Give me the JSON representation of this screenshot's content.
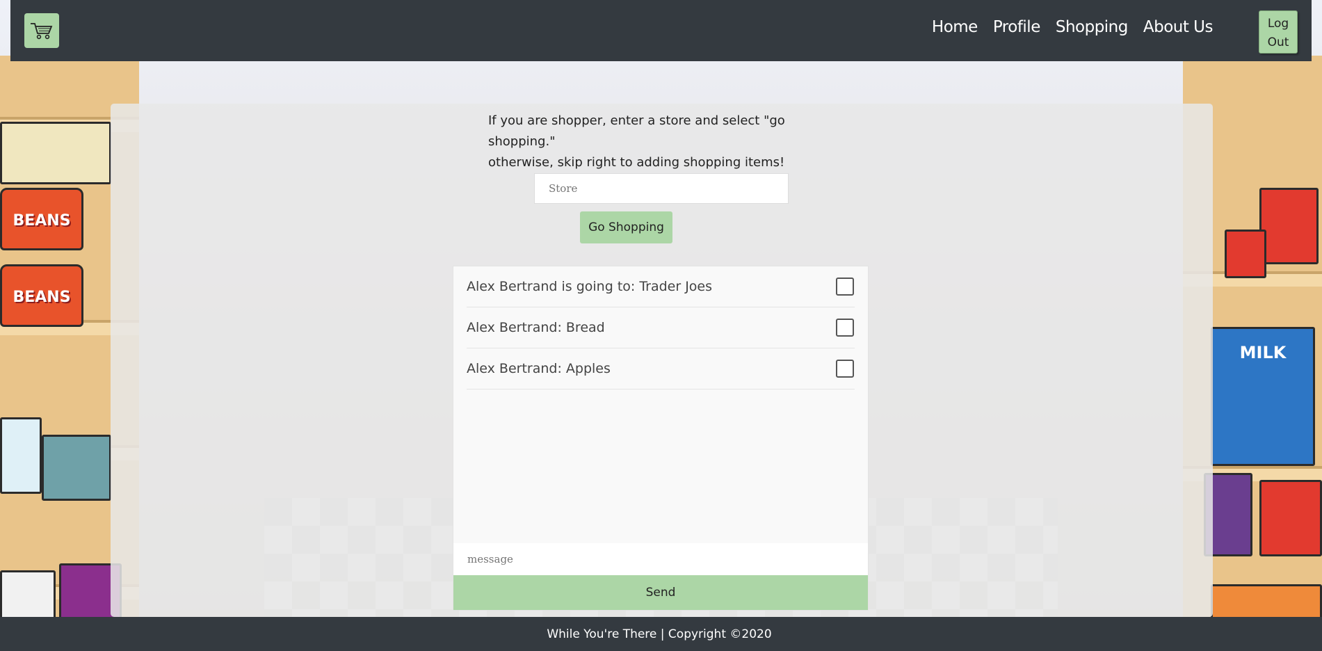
{
  "nav": {
    "brand_icon": "shopping-cart-icon",
    "links": [
      "Home",
      "Profile",
      "Shopping",
      "About Us"
    ],
    "logout_label": "Log\nOut"
  },
  "main": {
    "intro_line1": "If you are shopper, enter a store and select \"go shopping.\"",
    "intro_line2": "otherwise, skip right to adding shopping items!",
    "store_placeholder": "Store",
    "go_shopping_label": "Go Shopping"
  },
  "chat": {
    "items": [
      {
        "text": "Alex Bertrand is going to: Trader Joes",
        "checked": false
      },
      {
        "text": "Alex Bertrand: Bread",
        "checked": false
      },
      {
        "text": "Alex Bertrand: Apples",
        "checked": false
      }
    ],
    "message_placeholder": "message",
    "send_label": "Send"
  },
  "decor": {
    "can_label": "BEANS",
    "box_label": "MILK"
  },
  "footer": {
    "text": "While You're There | Copyright ©2020"
  },
  "colors": {
    "navbar": "#343a40",
    "accent_green": "#acd6a6"
  }
}
